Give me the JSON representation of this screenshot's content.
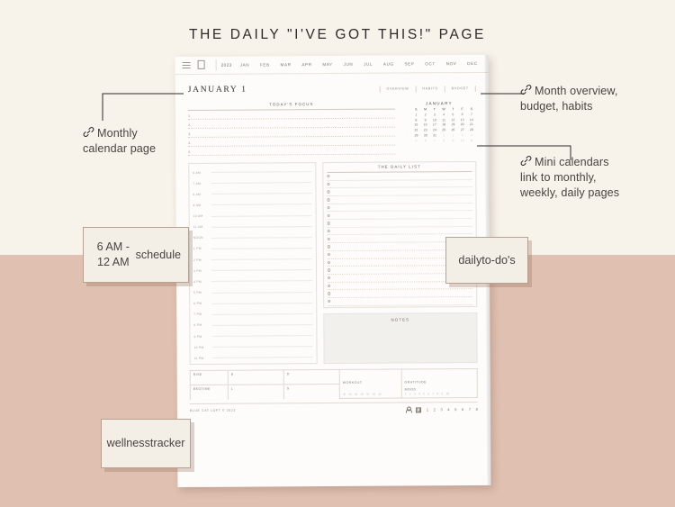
{
  "title": "THE DAILY \"I'VE GOT THIS!\" PAGE",
  "background": {
    "top_color": "#f7f2ea",
    "bottom_color": "#e0c0b0"
  },
  "planner": {
    "monthbar": {
      "menu_icon": "hamburger-menu-icon",
      "page_icon": "page-icon",
      "year": "2023",
      "months": [
        "JAN",
        "FEB",
        "MAR",
        "APR",
        "MAY",
        "JUN",
        "JUL",
        "AUG",
        "SEP",
        "OCT",
        "NOV",
        "DEC"
      ]
    },
    "header": {
      "date": "JANUARY 1",
      "tabs": [
        "OVERVIEW",
        "HABITS",
        "BUDGET"
      ]
    },
    "focus": {
      "title": "TODAY'S FOCUS",
      "items": [
        "1.",
        "2.",
        "3.",
        "4.",
        "5."
      ]
    },
    "mini_calendar": {
      "month": "JANUARY",
      "dow": [
        "S",
        "M",
        "T",
        "W",
        "T",
        "F",
        "S"
      ],
      "weeks": [
        {
          "wk": "1",
          "days": [
            "1",
            "2",
            "3",
            "4",
            "5",
            "6",
            "7"
          ],
          "out": []
        },
        {
          "wk": "2",
          "days": [
            "8",
            "9",
            "10",
            "11",
            "12",
            "13",
            "14"
          ],
          "out": []
        },
        {
          "wk": "3",
          "days": [
            "15",
            "16",
            "17",
            "18",
            "19",
            "20",
            "21"
          ],
          "out": []
        },
        {
          "wk": "4",
          "days": [
            "22",
            "23",
            "24",
            "25",
            "26",
            "27",
            "28"
          ],
          "out": []
        },
        {
          "wk": "5",
          "days": [
            "29",
            "30",
            "31",
            "1",
            "2",
            "3",
            "4"
          ],
          "out": [
            3,
            4,
            5,
            6
          ]
        },
        {
          "wk": "6",
          "days": [
            "5",
            "6",
            "7",
            "8",
            "9",
            "10",
            "11"
          ],
          "out": [
            0,
            1,
            2,
            3,
            4,
            5,
            6
          ]
        }
      ]
    },
    "schedule": {
      "times": [
        "6 AM",
        "7 AM",
        "8 AM",
        "9 AM",
        "10 AM",
        "11 AM",
        "NOON",
        "1 PM",
        "2 PM",
        "3 PM",
        "4 PM",
        "5 PM",
        "6 PM",
        "7 PM",
        "8 PM",
        "9 PM",
        "10 PM",
        "11 PM"
      ]
    },
    "daily_list": {
      "title": "THE DAILY LIST",
      "rows": 17
    },
    "notes": {
      "title": "NOTES"
    },
    "wellness": {
      "rise_label": "RISE",
      "bedtime_label": "BEDTIME",
      "b_label": "B",
      "l_label": "L",
      "d_label": "D",
      "s_label": "S",
      "workout_label": "WORKOUT",
      "workout_marks": [
        "W",
        "W",
        "W",
        "W",
        "W",
        "W",
        "W"
      ],
      "gratitude_label": "GRATITUDE",
      "mood_label": "MOOD",
      "mood_scale": [
        "1",
        "2",
        "3",
        "4",
        "5",
        "6",
        "7",
        "8",
        "9",
        "10"
      ]
    },
    "footer": {
      "copyright": "BLUE CAT LOFT © 2023",
      "person_icon": "person-icon",
      "calendar_icon": "calendar-icon",
      "page_numbers": [
        "1",
        "2",
        "3",
        "4",
        "5",
        "6",
        "7",
        "8"
      ]
    }
  },
  "annotations": {
    "monthly_calendar": {
      "icon": "link-icon",
      "line1": "Monthly",
      "line2": "calendar page"
    },
    "month_overview": {
      "icon": "link-icon",
      "line1": "Month overview,",
      "line2": "budget, habits"
    },
    "mini_calendars": {
      "icon": "link-icon",
      "line1": "Mini calendars",
      "line2": "link to monthly,",
      "line3": "weekly, daily pages"
    }
  },
  "callouts": {
    "schedule": "6 AM - 12 AM\nschedule",
    "todos": "daily\nto-do's",
    "wellness": "wellness\ntracker"
  }
}
